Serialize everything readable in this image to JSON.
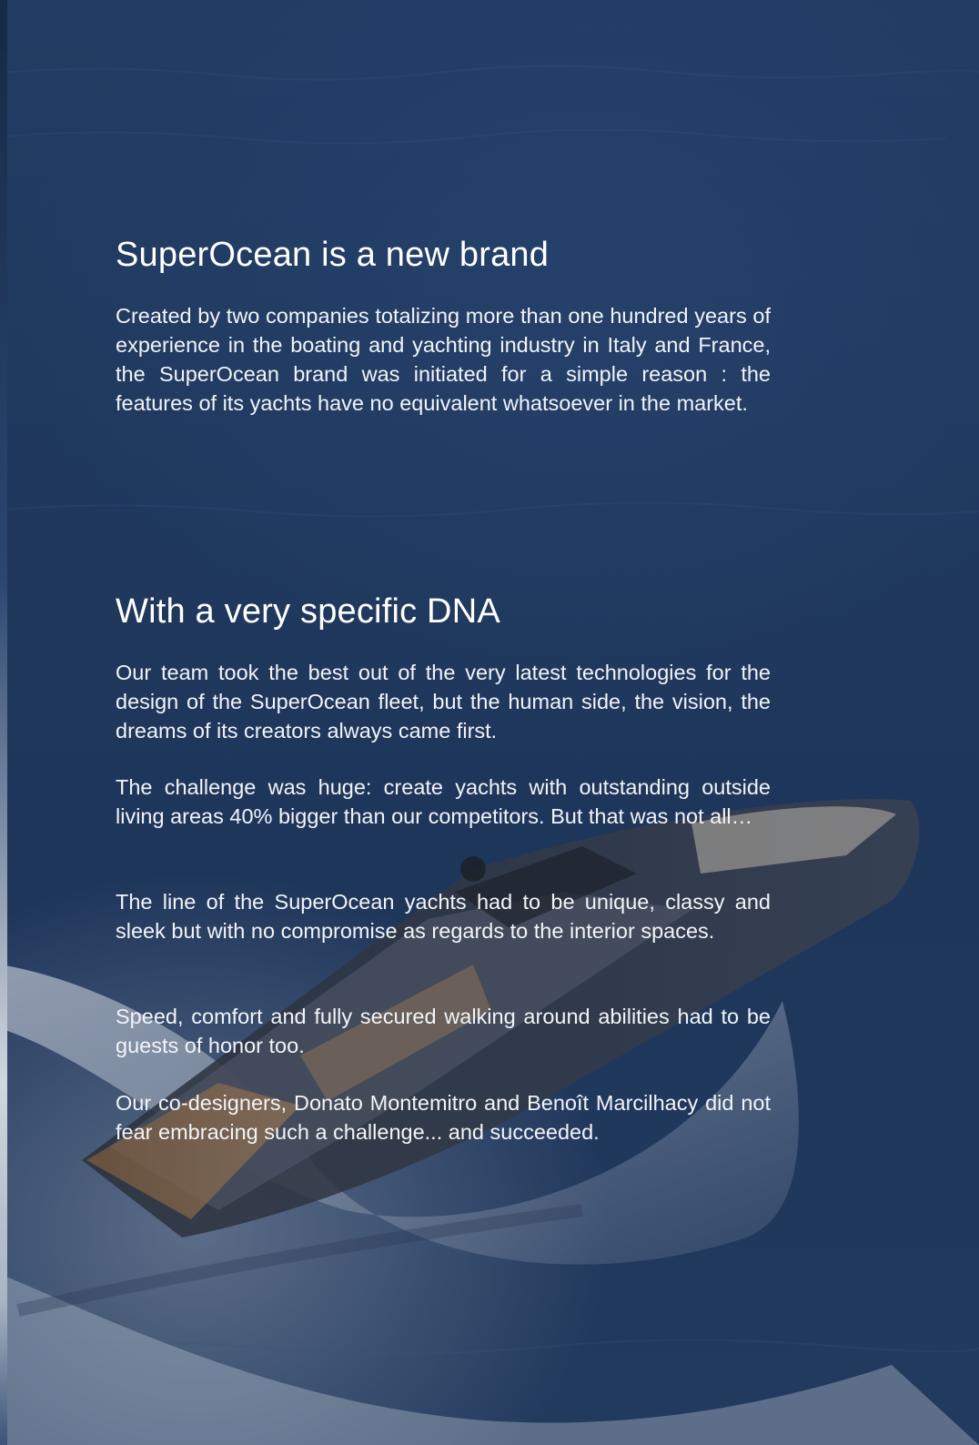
{
  "section_brand": {
    "heading": "SuperOcean is a new brand",
    "body": "Created by two companies totalizing more than one hundred years of experience in the boating and yachting industry in Italy and France, the SuperOcean brand was initiated for a simple reason : the features of its yachts have no equivalent whatsoever in the market."
  },
  "section_dna": {
    "heading": "With a very specific DNA",
    "paragraphs": [
      "Our team took the best out of the very latest technologies for the design of the SuperOcean fleet, but the human side, the vision, the dreams of its creators always came first.",
      "The challenge was huge: create yachts with outstanding outside living areas 40% bigger than our competitors. But that was not all…",
      "The line of the SuperOcean yachts had to be unique, classy and sleek but with no compromise as regards to the interior spaces.",
      "Speed, comfort and fully secured walking around abilities had to be guests of honor too.",
      "Our co-designers, Donato Montemitro and Benoît Marcilhacy did not fear embracing such a challenge... and succeeded."
    ]
  },
  "background": {
    "scene": "yacht-at-sea-photo",
    "sea_color": "#1f365b",
    "overlay_color": "#223c63"
  }
}
